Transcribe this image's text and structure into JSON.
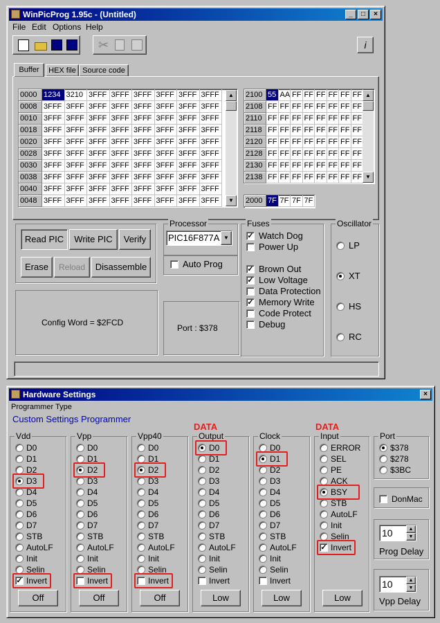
{
  "main": {
    "title": "WinPicProg 1.95c - (Untitled)",
    "menu": [
      "File",
      "Edit",
      "Options",
      "Help"
    ],
    "tabs": [
      "Buffer",
      "HEX file",
      "Source code"
    ],
    "prog_rows": [
      [
        "0000",
        "1234",
        "3210",
        "3FFF",
        "3FFF",
        "3FFF",
        "3FFF",
        "3FFF",
        "3FFF"
      ],
      [
        "0008",
        "3FFF",
        "3FFF",
        "3FFF",
        "3FFF",
        "3FFF",
        "3FFF",
        "3FFF",
        "3FFF"
      ],
      [
        "0010",
        "3FFF",
        "3FFF",
        "3FFF",
        "3FFF",
        "3FFF",
        "3FFF",
        "3FFF",
        "3FFF"
      ],
      [
        "0018",
        "3FFF",
        "3FFF",
        "3FFF",
        "3FFF",
        "3FFF",
        "3FFF",
        "3FFF",
        "3FFF"
      ],
      [
        "0020",
        "3FFF",
        "3FFF",
        "3FFF",
        "3FFF",
        "3FFF",
        "3FFF",
        "3FFF",
        "3FFF"
      ],
      [
        "0028",
        "3FFF",
        "3FFF",
        "3FFF",
        "3FFF",
        "3FFF",
        "3FFF",
        "3FFF",
        "3FFF"
      ],
      [
        "0030",
        "3FFF",
        "3FFF",
        "3FFF",
        "3FFF",
        "3FFF",
        "3FFF",
        "3FFF",
        "3FFF"
      ],
      [
        "0038",
        "3FFF",
        "3FFF",
        "3FFF",
        "3FFF",
        "3FFF",
        "3FFF",
        "3FFF",
        "3FFF"
      ],
      [
        "0040",
        "3FFF",
        "3FFF",
        "3FFF",
        "3FFF",
        "3FFF",
        "3FFF",
        "3FFF",
        "3FFF"
      ],
      [
        "0048",
        "3FFF",
        "3FFF",
        "3FFF",
        "3FFF",
        "3FFF",
        "3FFF",
        "3FFF",
        "3FFF"
      ]
    ],
    "eeprom_rows": [
      [
        "2100",
        "55",
        "AA",
        "FF",
        "FF",
        "FF",
        "FF",
        "FF",
        "FF"
      ],
      [
        "2108",
        "FF",
        "FF",
        "FF",
        "FF",
        "FF",
        "FF",
        "FF",
        "FF"
      ],
      [
        "2110",
        "FF",
        "FF",
        "FF",
        "FF",
        "FF",
        "FF",
        "FF",
        "FF"
      ],
      [
        "2118",
        "FF",
        "FF",
        "FF",
        "FF",
        "FF",
        "FF",
        "FF",
        "FF"
      ],
      [
        "2120",
        "FF",
        "FF",
        "FF",
        "FF",
        "FF",
        "FF",
        "FF",
        "FF"
      ],
      [
        "2128",
        "FF",
        "FF",
        "FF",
        "FF",
        "FF",
        "FF",
        "FF",
        "FF"
      ],
      [
        "2130",
        "FF",
        "FF",
        "FF",
        "FF",
        "FF",
        "FF",
        "FF",
        "FF"
      ],
      [
        "2138",
        "FF",
        "FF",
        "FF",
        "FF",
        "FF",
        "FF",
        "FF",
        "FF"
      ]
    ],
    "id_row": [
      "2000",
      "7F",
      "7F",
      "7F",
      "7F"
    ],
    "buttons": {
      "read": "Read PIC",
      "write": "Write PIC",
      "verify": "Verify",
      "erase": "Erase",
      "reload": "Reload",
      "disassemble": "Disassemble"
    },
    "processor": {
      "label": "Processor",
      "value": "PIC16F877A"
    },
    "auto_prog": "Auto Prog",
    "config_word": "Config Word = $2FCD",
    "port": "Port : $378",
    "fuses": {
      "label": "Fuses",
      "items": [
        {
          "label": "Watch Dog",
          "checked": true
        },
        {
          "label": "Power Up",
          "checked": false
        },
        {
          "label": "Brown Out",
          "checked": true
        },
        {
          "label": "Low Voltage",
          "checked": true
        },
        {
          "label": "Data Protection",
          "checked": false
        },
        {
          "label": "Memory Write",
          "checked": true
        },
        {
          "label": "Code Protect",
          "checked": false
        },
        {
          "label": "Debug",
          "checked": false
        }
      ]
    },
    "oscillator": {
      "label": "Oscillator",
      "items": [
        "LP",
        "XT",
        "HS",
        "RC"
      ],
      "selected": "XT"
    }
  },
  "hw": {
    "title": "Hardware Settings",
    "programmer_type": "Programmer Type",
    "custom": "Custom Settings Programmer",
    "data_label": "DATA",
    "pins": [
      "D0",
      "D1",
      "D2",
      "D3",
      "D4",
      "D5",
      "D6",
      "D7",
      "STB",
      "AutoLF",
      "Init",
      "Selin"
    ],
    "input_pins": [
      "ERROR",
      "SEL",
      "PE",
      "ACK",
      "BSY",
      "STB",
      "AutoLF",
      "Init",
      "Selin"
    ],
    "invert": "Invert",
    "groups": [
      {
        "label": "Vdd",
        "selected": "D3",
        "invert": true,
        "button": "Off"
      },
      {
        "label": "Vpp",
        "selected": "D2",
        "invert": false,
        "button": "Off"
      },
      {
        "label": "Vpp40",
        "selected": "D2",
        "invert": false,
        "button": "Off"
      },
      {
        "label": "Output",
        "selected": "D0",
        "invert": false,
        "button": "Low"
      },
      {
        "label": "Clock",
        "selected": "D1",
        "invert": false,
        "button": "Low"
      },
      {
        "label": "Input",
        "selected": "BSY",
        "invert": true,
        "button": "Low"
      }
    ],
    "port": {
      "label": "Port",
      "items": [
        "$378",
        "$278",
        "$3BC"
      ],
      "selected": "$378"
    },
    "donmac": "DonMac",
    "prog_delay": {
      "value": "10",
      "label": "Prog Delay"
    },
    "vpp_delay": {
      "value": "10",
      "label": "Vpp Delay"
    },
    "accent": "#e02020"
  }
}
